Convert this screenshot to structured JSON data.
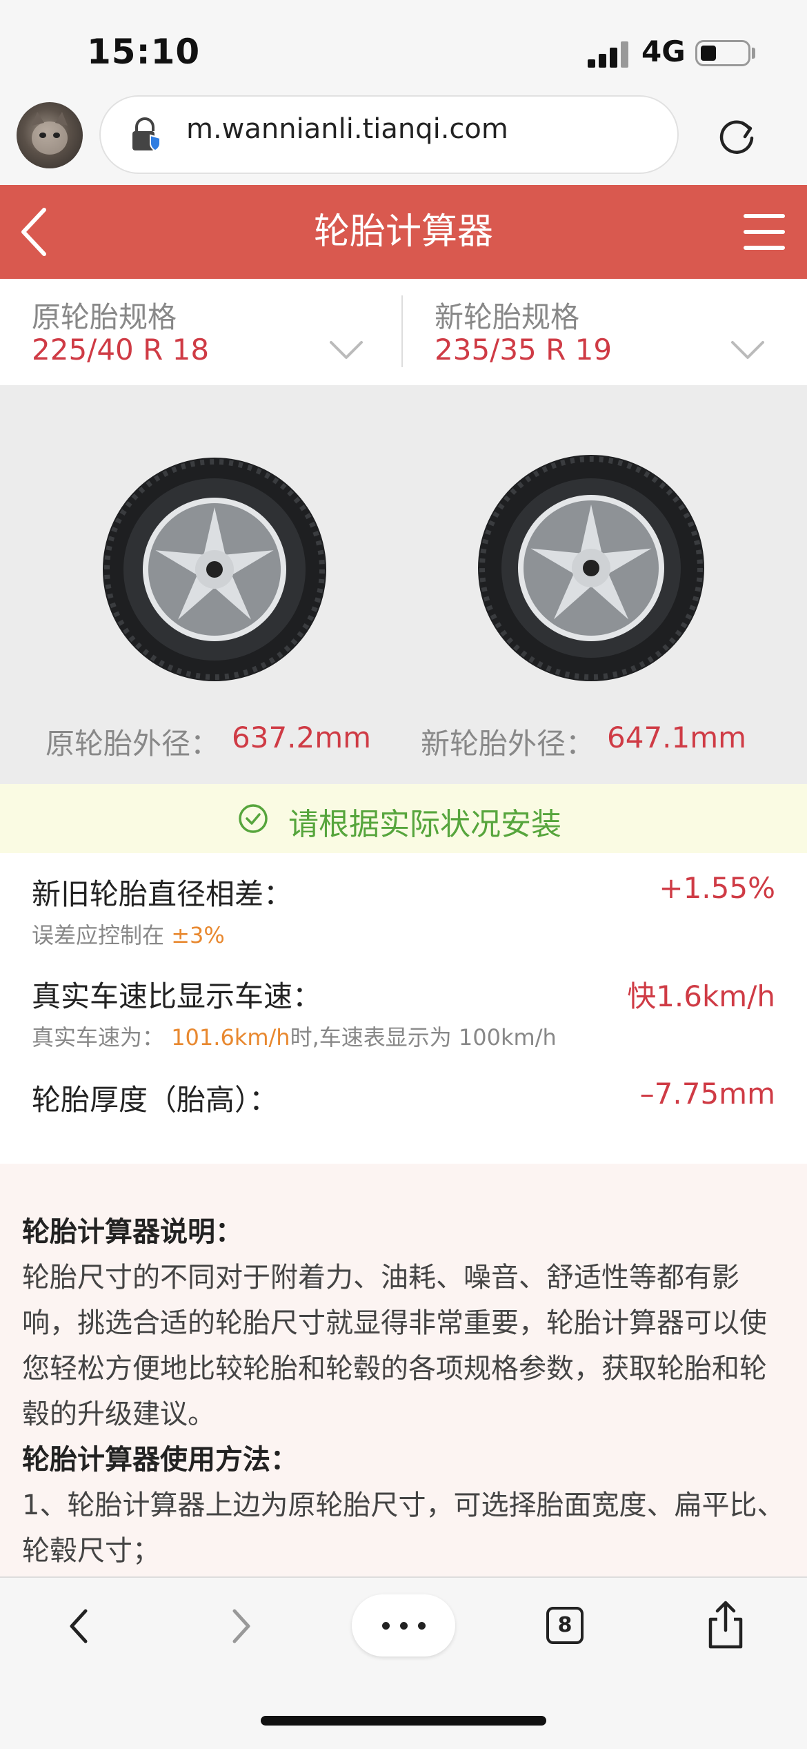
{
  "status_bar": {
    "time": "15:10",
    "network": "4G",
    "battery_level": 0.35
  },
  "browser": {
    "url": "m.wannianli.tianqi.com",
    "tab_count": "8"
  },
  "header": {
    "title": "轮胎计算器"
  },
  "specs": {
    "original": {
      "label": "原轮胎规格",
      "value": "225/40 R 18"
    },
    "new": {
      "label": "新轮胎规格",
      "value": "235/35 R 19"
    }
  },
  "diameters": {
    "original": {
      "label": "原轮胎外径：",
      "value": "637.2mm"
    },
    "new": {
      "label": "新轮胎外径：",
      "value": "647.1mm"
    }
  },
  "notice": {
    "text": "请根据实际状况安装"
  },
  "results": {
    "diameter_diff": {
      "label": "新旧轮胎直径相差：",
      "value": "+1.55%",
      "sub_prefix": "误差应控制在",
      "sub_value": "±3%"
    },
    "speed": {
      "label": "真实车速比显示车速：",
      "value": "快1.6km/h",
      "sub_prefix": "真实车速为：",
      "sub_value": "101.6km/h",
      "sub_suffix": "时,车速表显示为 100km/h"
    },
    "thickness": {
      "label": "轮胎厚度（胎高）：",
      "value": "–7.75mm"
    }
  },
  "explanation": {
    "heading1": "轮胎计算器说明：",
    "body1": "轮胎尺寸的不同对于附着力、油耗、噪音、舒适性等都有影响，挑选合适的轮胎尺寸就显得非常重要，轮胎计算器可以使您轻松方便地比较轮胎和轮毂的各项规格参数，获取轮胎和轮毂的升级建议。",
    "heading2": "轮胎计算器使用方法：",
    "body2": "1、轮胎计算器上边为原轮胎尺寸，可选择胎面宽度、扁平比、轮毂尺寸；"
  },
  "colors": {
    "header_red": "#d9594f",
    "value_red": "#cf3b45",
    "notice_green": "#56a53c",
    "hint_orange": "#e8882f"
  }
}
